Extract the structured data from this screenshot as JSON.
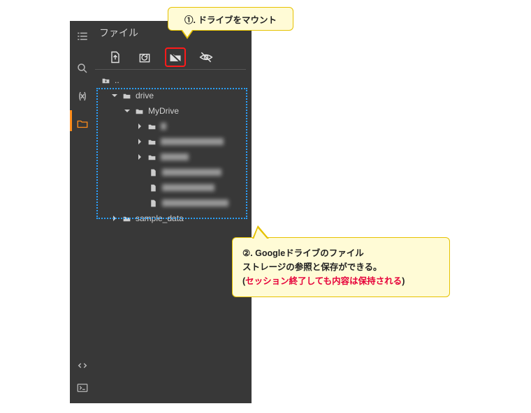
{
  "header": {
    "title": "ファイル"
  },
  "toolbar": {
    "upload": "upload-icon",
    "refresh": "refresh-icon",
    "mount": "mount-drive-icon",
    "hidden": "toggle-hidden-icon"
  },
  "tree": {
    "root": "..",
    "drive": "drive",
    "mydrive": "MyDrive",
    "sample": "sample_data"
  },
  "callout1": {
    "text": "①. ドライブをマウント"
  },
  "callout2": {
    "line1": "②. Googleドライブのファイル",
    "line2": "ストレージの参照と保存ができる。",
    "line3a": "(",
    "line3b": "セッション終了しても内容は保持される",
    "line3c": ")"
  }
}
